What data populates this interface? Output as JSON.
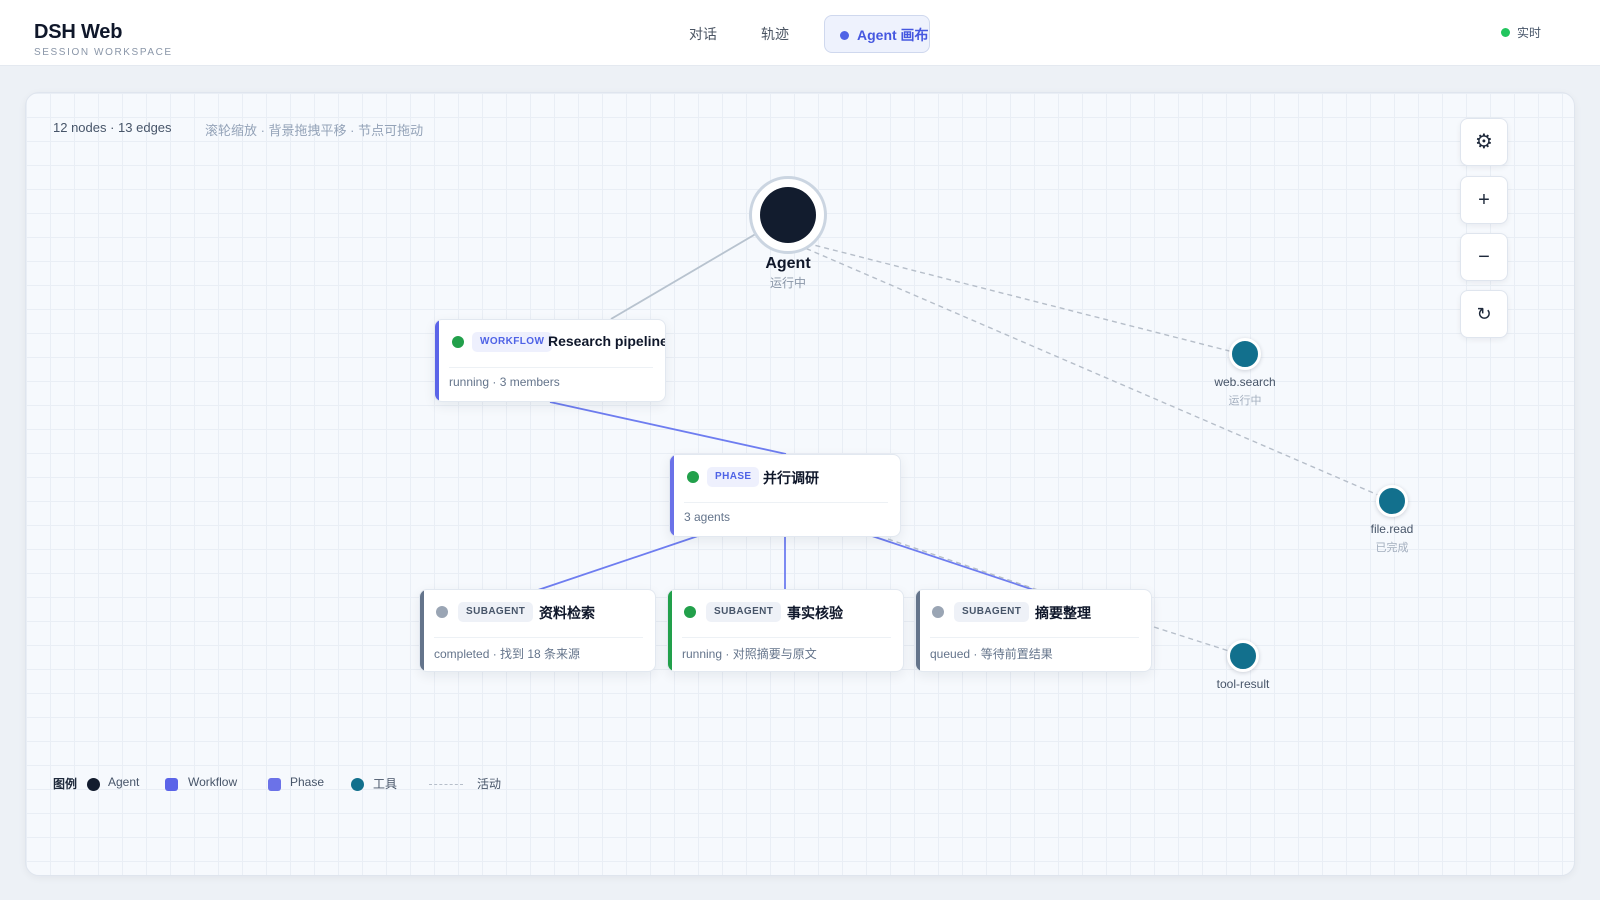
{
  "header": {
    "title": "DSH Web",
    "subtitle": "SESSION WORKSPACE",
    "tabs": [
      {
        "label": "对话",
        "active": false
      },
      {
        "label": "轨迹",
        "active": false
      },
      {
        "label": "Agent 画布",
        "active": true
      }
    ],
    "live_status": "实时"
  },
  "canvas": {
    "stats": "12 nodes · 13 edges",
    "hint": "滚轮缩放 · 背景拖拽平移 · 节点可拖动",
    "agent": {
      "name": "Agent",
      "status": "运行中"
    },
    "workflow": {
      "tag": "WORKFLOW",
      "title": "Research pipeline",
      "subtitle": "running · 3 members",
      "status_color": "#22a04b"
    },
    "phase": {
      "tag": "PHASE",
      "title": "并行调研",
      "subtitle": "3 agents",
      "status_color": "#22a04b"
    },
    "subagents": [
      {
        "tag": "SUBAGENT",
        "title": "资料检索",
        "subtitle": "completed · 找到 18 条来源",
        "status": "completed",
        "status_color": "#9aa5b4",
        "bar_color": "#64748b"
      },
      {
        "tag": "SUBAGENT",
        "title": "事实核验",
        "subtitle": "running · 对照摘要与原文",
        "status": "running",
        "status_color": "#22a04b",
        "bar_color": "#22a04b"
      },
      {
        "tag": "SUBAGENT",
        "title": "摘要整理",
        "subtitle": "queued · 等待前置结果",
        "status": "queued",
        "status_color": "#9aa5b4",
        "bar_color": "#64748b"
      }
    ],
    "tools": [
      {
        "name": "web.search",
        "status": "运行中"
      },
      {
        "name": "file.read",
        "status": "已完成"
      },
      {
        "name": "tool-result",
        "status": ""
      }
    ],
    "controls": {
      "settings": "⚙",
      "zoom_in": "+",
      "zoom_out": "−",
      "reset": "↻"
    },
    "legend": {
      "title": "图例",
      "agent": "Agent",
      "workflow": "Workflow",
      "phase": "Phase",
      "tool": "工具",
      "activity": "活动"
    },
    "colors": {
      "accent": "#4f63e6",
      "agent": "#121c2e",
      "workflow": "#5b64e8",
      "phase": "#6b72e8",
      "tool": "#12708d",
      "running": "#22a04b",
      "idle": "#9aa5b4"
    }
  }
}
